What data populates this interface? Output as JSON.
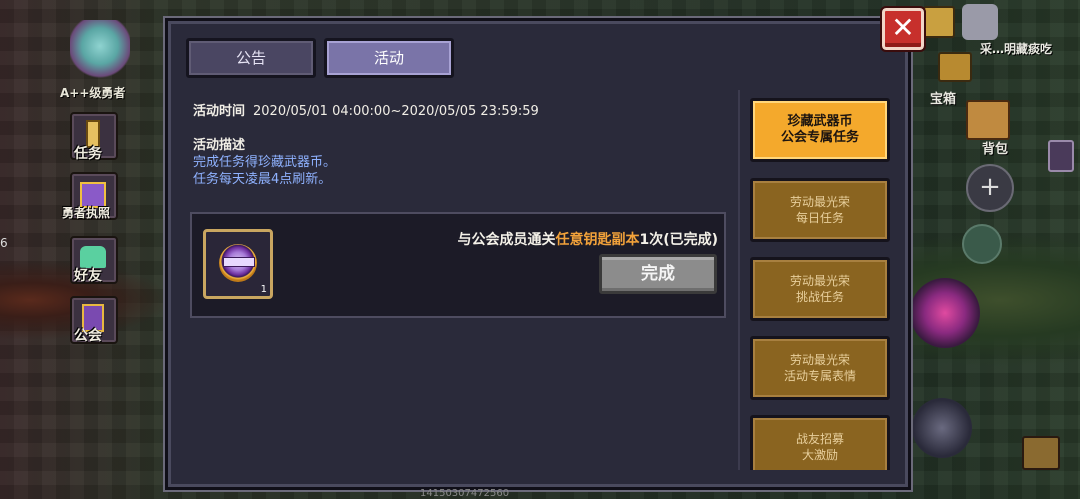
{
  "left_hud": {
    "rank": "A++级勇者",
    "edge_number": "6",
    "buttons": [
      {
        "label": "任务",
        "icon": "scroll-icon"
      },
      {
        "label": "勇者执照",
        "icon": "license-icon"
      },
      {
        "label": "好友",
        "icon": "friends-icon"
      },
      {
        "label": "公会",
        "icon": "guild-icon"
      }
    ]
  },
  "right_hud": {
    "top_text": "采…明藏痰吃",
    "chest_label": "宝箱",
    "backpack_label": "背包"
  },
  "tabs": [
    {
      "label": "公告",
      "active": false
    },
    {
      "label": "活动",
      "active": true
    }
  ],
  "event": {
    "time_label": "活动时间",
    "time_value": "2020/05/01 04:00:00~2020/05/05 23:59:59",
    "desc_title": "活动描述",
    "desc_lines": [
      "完成任务得珍藏武器币。",
      "任务每天凌晨4点刷新。"
    ]
  },
  "task": {
    "text_before": "与公会成员通关",
    "text_highlight": "任意钥匙副本",
    "text_after": "1次(已完成)",
    "reward_count": "1",
    "button_label": "完成"
  },
  "side_list": [
    {
      "line1": "珍藏武器币",
      "line2": "公会专属任务",
      "active": true
    },
    {
      "line1": "劳动最光荣",
      "line2": "每日任务",
      "active": false
    },
    {
      "line1": "劳动最光荣",
      "line2": "挑战任务",
      "active": false
    },
    {
      "line1": "劳动最光荣",
      "line2": "活动专属表情",
      "active": false
    },
    {
      "line1": "战友招募",
      "line2": "大激励",
      "active": false
    }
  ],
  "bottom_text": "14150307472560",
  "colors": {
    "panel_bg": "#2a2a3a",
    "highlight_orange": "#f2a23a",
    "desc_blue": "#8fb2ff",
    "side_active": "#f4a92c",
    "side_inactive": "#8a6420",
    "close_red": "#c7302c"
  }
}
